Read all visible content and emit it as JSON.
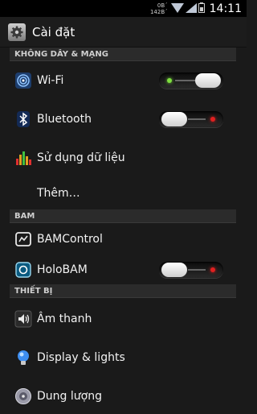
{
  "status_bar": {
    "data_up": "0B´",
    "data_rate": "142B´",
    "time": "14:11"
  },
  "app": {
    "title": "Cài đặt",
    "icon": "settings-gear-icon"
  },
  "sections": {
    "wireless": "KHÔNG DÂY & MẠNG",
    "bam": "BAM",
    "device": "THIẾT BỊ"
  },
  "items": {
    "wifi": {
      "label": "Wi-Fi",
      "icon": "wifi-icon",
      "toggle_on": true
    },
    "bluetooth": {
      "label": "Bluetooth",
      "icon": "bluetooth-icon",
      "toggle_on": false
    },
    "data_usage": {
      "label": "Sử dụng dữ liệu",
      "icon": "data-usage-icon"
    },
    "more": {
      "label": "Thêm…"
    },
    "bamcontrol": {
      "label": "BAMControl",
      "icon": "bamcontrol-icon"
    },
    "holobam": {
      "label": "HoloBAM",
      "icon": "holobam-icon",
      "toggle_on": false
    },
    "sound": {
      "label": "Âm thanh",
      "icon": "speaker-icon"
    },
    "display": {
      "label": "Display & lights",
      "icon": "lightbulb-icon"
    },
    "storage": {
      "label": "Dung lượng",
      "icon": "storage-disc-icon"
    }
  },
  "colors": {
    "led_on": "#7ee040",
    "led_off": "#e02020",
    "background": "#1a1a1a"
  }
}
